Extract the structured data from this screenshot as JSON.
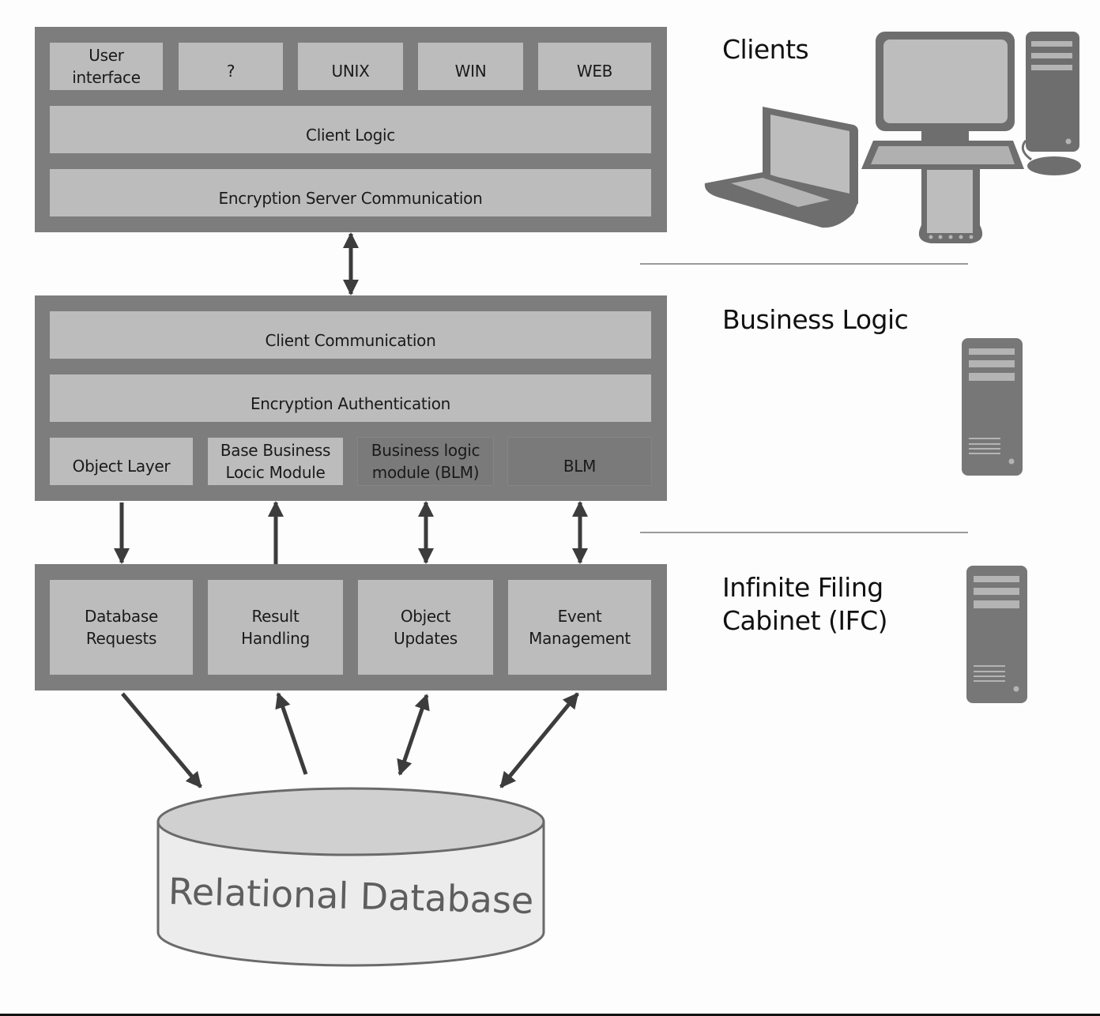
{
  "diagram": {
    "tiers": {
      "clients": {
        "label": "Clients",
        "platform_boxes": [
          {
            "label": "User\ninterface"
          },
          {
            "label": "?"
          },
          {
            "label": "UNIX"
          },
          {
            "label": "WIN"
          },
          {
            "label": "WEB"
          }
        ],
        "client_logic": "Client Logic",
        "encryption_server_comm": "Encryption Server Communication",
        "icons": [
          "laptop-icon",
          "desktop-computer-icon",
          "tower-pc-icon",
          "mouse-icon",
          "pda-icon"
        ]
      },
      "business_logic": {
        "label": "Business Logic",
        "client_communication": "Client Communication",
        "encryption_authentication": "Encryption Authentication",
        "modules": [
          {
            "label": "Object Layer",
            "style": "light"
          },
          {
            "label": "Base Business\nLocic Module",
            "style": "light"
          },
          {
            "label": "Business logic\nmodule (BLM)",
            "style": "dark"
          },
          {
            "label": "BLM",
            "style": "dark"
          }
        ],
        "icon": "server-tower-icon"
      },
      "ifc": {
        "label": "Infinite Filing\nCabinet (IFC)",
        "components": [
          {
            "label": "Database\nRequests"
          },
          {
            "label": "Result\nHandling"
          },
          {
            "label": "Object\nUpdates"
          },
          {
            "label": "Event\nManagement"
          }
        ],
        "icon": "server-tower-icon"
      }
    },
    "database": {
      "label": "Relational Database"
    },
    "connections": [
      {
        "from": "clients",
        "to": "business_logic",
        "direction": "both"
      },
      {
        "from": "Object Layer",
        "to": "Database Requests",
        "direction": "down"
      },
      {
        "from": "Result Handling",
        "to": "Base Business Locic Module",
        "direction": "up"
      },
      {
        "from": "Business logic module (BLM)",
        "to": "Object Updates",
        "direction": "both"
      },
      {
        "from": "BLM",
        "to": "Event Management",
        "direction": "both"
      },
      {
        "from": "Database Requests",
        "to": "Relational Database",
        "direction": "to-db"
      },
      {
        "from": "Relational Database",
        "to": "Result Handling",
        "direction": "to-ifc"
      },
      {
        "from": "Object Updates",
        "to": "Relational Database",
        "direction": "both"
      },
      {
        "from": "Event Management",
        "to": "Relational Database",
        "direction": "both"
      }
    ],
    "colors": {
      "container": "#7d7d7d",
      "box": "#bcbcbc",
      "arrow": "#3c3c3c",
      "db_top": "#d0d0d0",
      "db_side": "#ececec"
    }
  }
}
